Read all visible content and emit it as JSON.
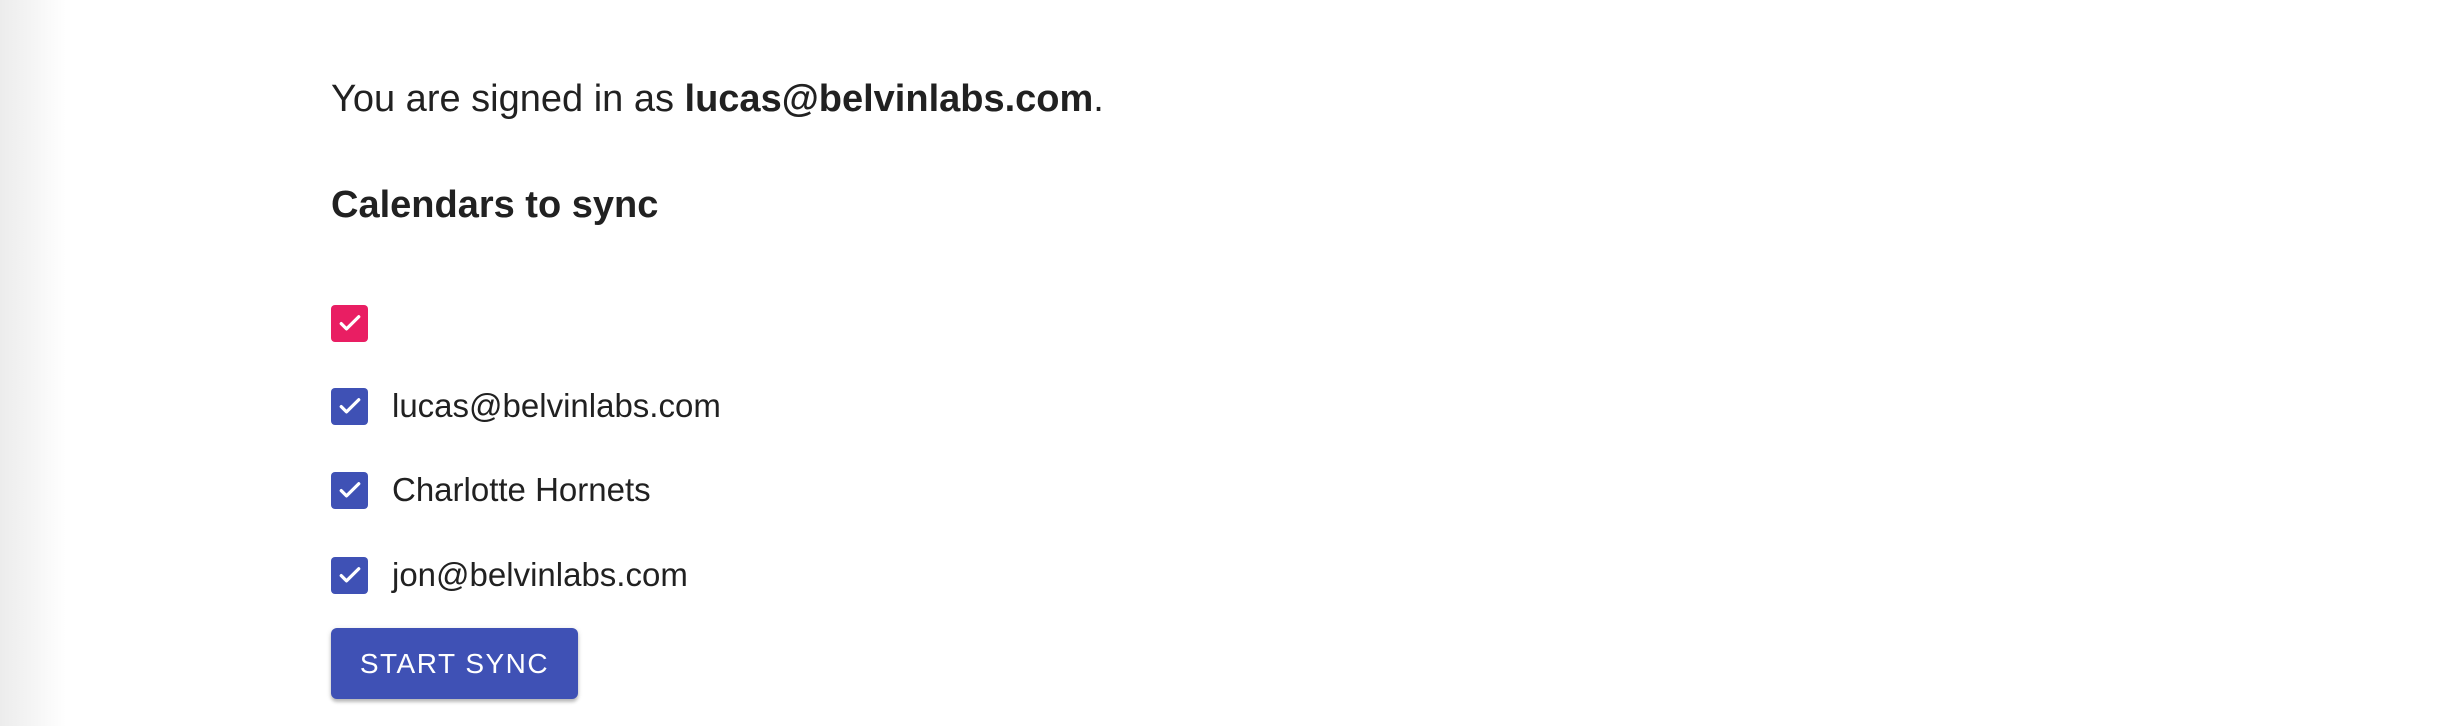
{
  "account": {
    "prefix": "You are signed in as ",
    "email": "lucas@belvinlabs.com",
    "suffix": "."
  },
  "calendars": {
    "heading": "Calendars to sync",
    "items": [
      {
        "label": "",
        "checked": true,
        "color": "#e91e63"
      },
      {
        "label": "lucas@belvinlabs.com",
        "checked": true,
        "color": "#3f51b5"
      },
      {
        "label": "Charlotte Hornets",
        "checked": true,
        "color": "#3f51b5"
      },
      {
        "label": "jon@belvinlabs.com",
        "checked": true,
        "color": "#3f51b5"
      }
    ]
  },
  "actions": {
    "start_label": "START SYNC"
  },
  "icons": {
    "checkbox": "checkmark-icon"
  }
}
